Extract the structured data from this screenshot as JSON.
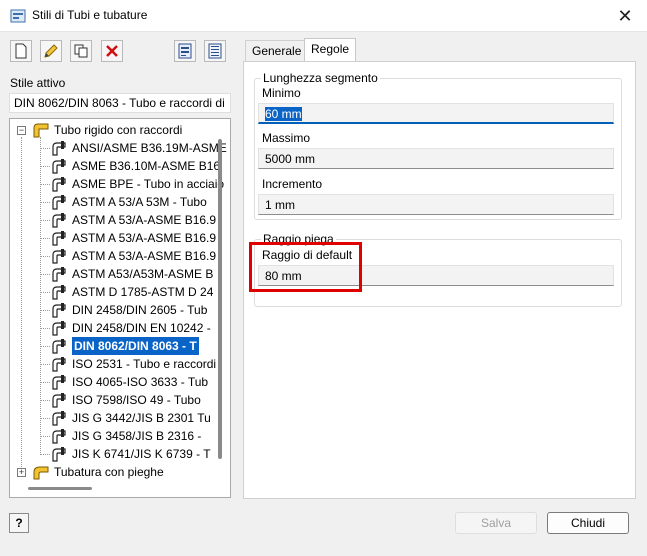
{
  "window": {
    "title": "Stili di Tubi e tubature",
    "close_glyph": "✕"
  },
  "toolbar": {
    "icons": [
      "new-style-icon",
      "edit-pencil-icon",
      "copy-icon",
      "delete-x-icon",
      "import-icon",
      "export-icon"
    ]
  },
  "active_style": {
    "label": "Stile attivo",
    "value": "DIN 8062/DIN 8063 - Tubo e raccordi di"
  },
  "tree": {
    "root1": {
      "label": "Tubo rigido con raccordi",
      "expander": "−"
    },
    "items": [
      "ANSI/ASME B36.19M-ASME",
      "ASME B36.10M-ASME B16",
      "ASME BPE - Tubo in acciaio",
      "ASTM A 53/A 53M - Tubo",
      "ASTM A 53/A-ASME B16.9",
      "ASTM A 53/A-ASME B16.9",
      "ASTM A 53/A-ASME B16.9",
      "ASTM A53/A53M-ASME B",
      "ASTM D 1785-ASTM D 24",
      "DIN 2458/DIN 2605 - Tub",
      "DIN 2458/DIN EN 10242 -",
      "DIN 8062/DIN 8063 - T",
      "ISO 2531 - Tubo e raccordi",
      "ISO 4065-ISO 3633 - Tub",
      "ISO 7598/ISO 49 - Tubo",
      "JIS G 3442/JIS B 2301 Tu",
      "JIS G 3458/JIS B 2316 -",
      "JIS K 6741/JIS K 6739 - T"
    ],
    "root2": {
      "label": "Tubatura con pieghe",
      "expander": "+"
    }
  },
  "tabs": [
    {
      "label": "Generale"
    },
    {
      "label": "Regole"
    }
  ],
  "segment_group": {
    "title": "Lunghezza segmento",
    "min_label": "Minimo",
    "min_value": "60 mm",
    "max_label": "Massimo",
    "max_value": "5000 mm",
    "inc_label": "Incremento",
    "inc_value": "1 mm"
  },
  "bend_group": {
    "title": "Raggio piega",
    "default_label": "Raggio di default",
    "default_value": "80 mm"
  },
  "footer": {
    "help_label": "?",
    "save_label": "Salva",
    "close_label": "Chiudi"
  },
  "colors": {
    "selection": "#0a64c8",
    "highlight_box": "#e00000",
    "focus_underline": "#005fb8"
  }
}
